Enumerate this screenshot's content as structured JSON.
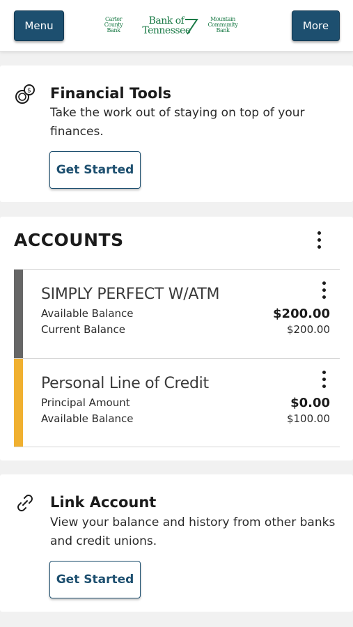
{
  "header": {
    "menu_label": "Menu",
    "more_label": "More",
    "logos": {
      "carter_county": [
        "Carter",
        "County",
        "Bank"
      ],
      "bank_of_tennessee": [
        "Bank of",
        "Tennessee"
      ],
      "mountain_community": [
        "Mountain",
        "Community",
        "Bank"
      ],
      "brand_color": "#1a7a46"
    }
  },
  "financial_tools": {
    "icon": "coins-icon",
    "title": "Financial Tools",
    "description": "Take the work out of staying on top of your finances.",
    "button_label": "Get Started"
  },
  "accounts": {
    "heading": "ACCOUNTS",
    "items": [
      {
        "name": "SIMPLY PERFECT W/ATM",
        "color": "#666666",
        "primary_label": "Available Balance",
        "primary_value": "$200.00",
        "secondary_label": "Current Balance",
        "secondary_value": "$200.00"
      },
      {
        "name": "Personal Line of Credit",
        "color": "#f0b030",
        "primary_label": "Principal Amount",
        "primary_value": "$0.00",
        "secondary_label": "Available Balance",
        "secondary_value": "$100.00"
      }
    ]
  },
  "link_account": {
    "icon": "link-icon",
    "title": "Link Account",
    "description": "View your balance and history from other banks and credit unions.",
    "button_label": "Get Started"
  },
  "colors": {
    "primary": "#1d4f6f",
    "background": "#f1f1f1"
  }
}
